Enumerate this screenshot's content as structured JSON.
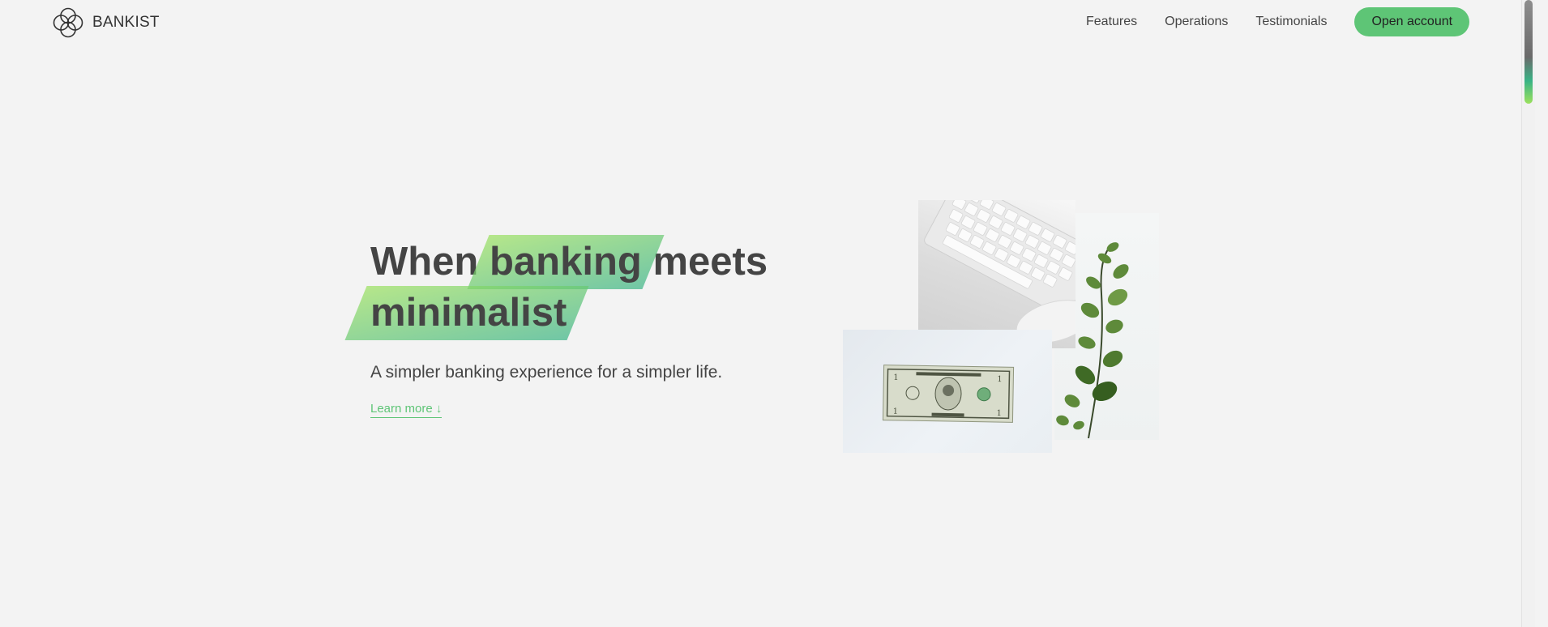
{
  "brand": {
    "name": "BANKIST",
    "logo_icon": "four-circles-logo-icon",
    "accent_color": "#5ec576",
    "gradient": [
      "#9be15d",
      "#39b385"
    ]
  },
  "nav": {
    "links": [
      "Features",
      "Operations",
      "Testimonials"
    ],
    "cta_label": "Open account"
  },
  "hero": {
    "title_part1": "When",
    "title_highlight1": "banking",
    "title_part2": "meets",
    "title_highlight2": "minimalist",
    "subtitle": "A simpler banking experience for a simpler life.",
    "learn_more": "Learn more ↓"
  },
  "hero_images": [
    "keyboard-and-mouse-photo",
    "dollar-bill-photo",
    "eucalyptus-plant-photo"
  ]
}
